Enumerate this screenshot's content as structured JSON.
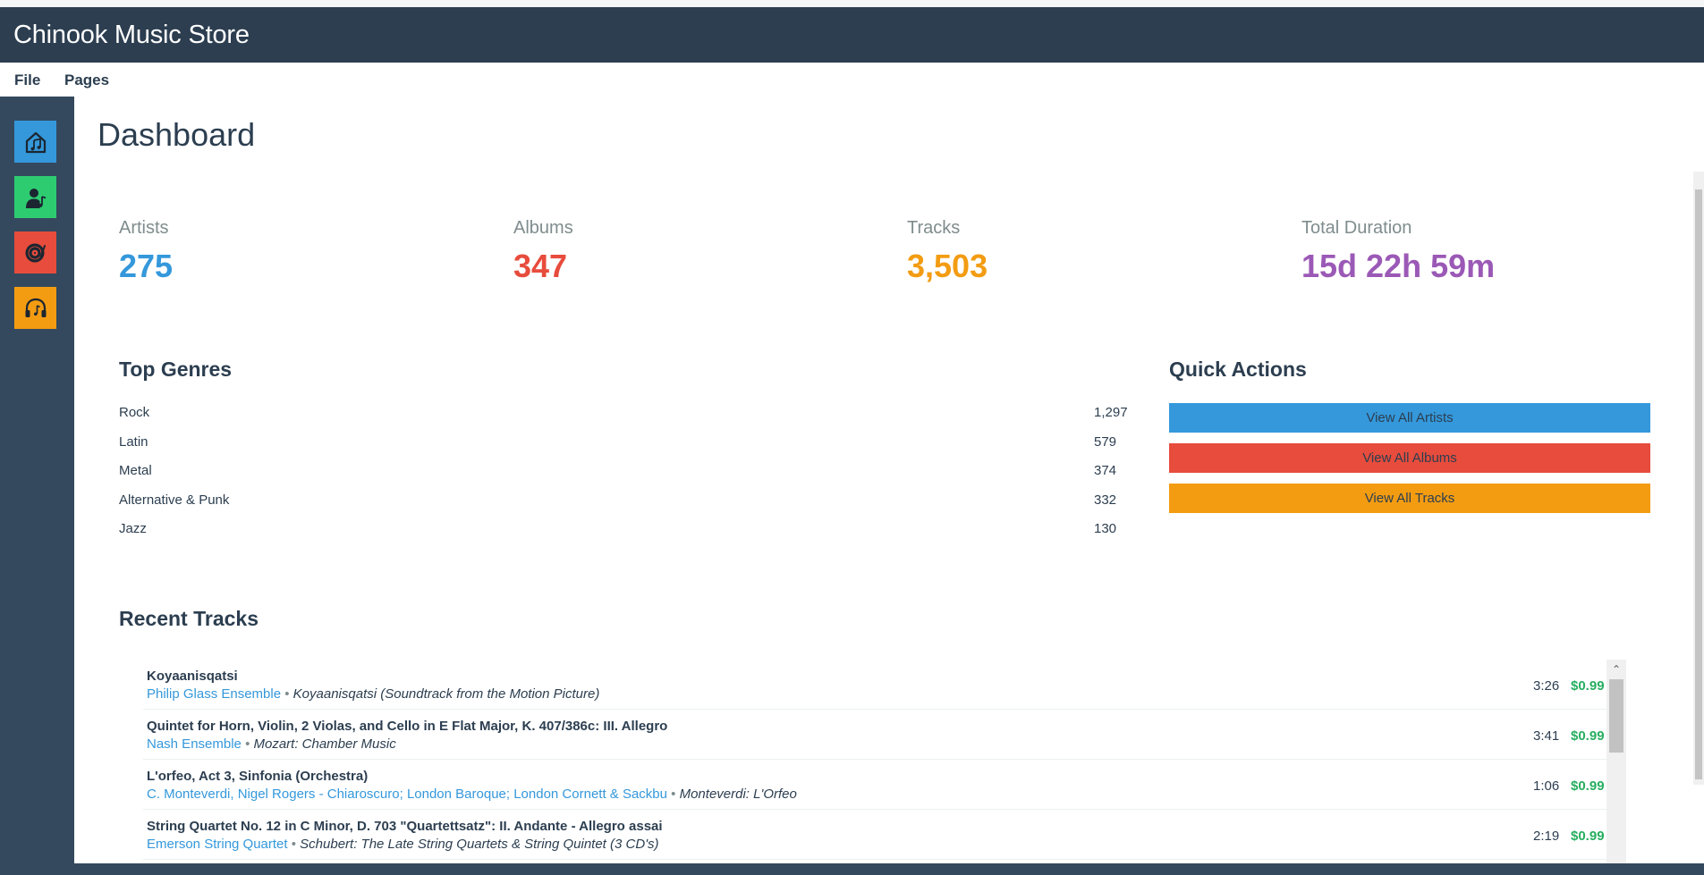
{
  "app": {
    "title": "Chinook Music Store"
  },
  "menu": {
    "file": "File",
    "pages": "Pages"
  },
  "sidebar": {
    "items": [
      {
        "name": "home",
        "icon": "home-music-icon",
        "color": "#3498db"
      },
      {
        "name": "artists",
        "icon": "artist-icon",
        "color": "#2ecc71"
      },
      {
        "name": "albums",
        "icon": "vinyl-record-icon",
        "color": "#e74c3c"
      },
      {
        "name": "tracks",
        "icon": "headphones-icon",
        "color": "#f39c12"
      }
    ]
  },
  "dashboard": {
    "title": "Dashboard",
    "stats": [
      {
        "label": "Artists",
        "value": "275",
        "color": "#3498db"
      },
      {
        "label": "Albums",
        "value": "347",
        "color": "#e74c3c"
      },
      {
        "label": "Tracks",
        "value": "3,503",
        "color": "#f39c12"
      },
      {
        "label": "Total Duration",
        "value": "15d 22h 59m",
        "color": "#9b59b6"
      }
    ],
    "top_genres": {
      "title": "Top Genres",
      "items": [
        {
          "name": "Rock",
          "count": "1,297"
        },
        {
          "name": "Latin",
          "count": "579"
        },
        {
          "name": "Metal",
          "count": "374"
        },
        {
          "name": "Alternative & Punk",
          "count": "332"
        },
        {
          "name": "Jazz",
          "count": "130"
        }
      ]
    },
    "quick_actions": {
      "title": "Quick Actions",
      "buttons": [
        {
          "label": "View All Artists",
          "color": "#3498db"
        },
        {
          "label": "View All Albums",
          "color": "#e74c3c"
        },
        {
          "label": "View All Tracks",
          "color": "#f39c12"
        }
      ]
    },
    "recent_tracks": {
      "title": "Recent Tracks",
      "separator": "•",
      "items": [
        {
          "name": "Koyaanisqatsi",
          "artist": "Philip Glass Ensemble",
          "album": "Koyaanisqatsi (Soundtrack from the Motion Picture)",
          "duration": "3:26",
          "price": "$0.99"
        },
        {
          "name": "Quintet for Horn, Violin, 2 Violas, and Cello in E Flat Major, K. 407/386c: III. Allegro",
          "artist": "Nash Ensemble",
          "album": "Mozart: Chamber Music",
          "duration": "3:41",
          "price": "$0.99"
        },
        {
          "name": "L'orfeo, Act 3, Sinfonia (Orchestra)",
          "artist": "C. Monteverdi, Nigel Rogers - Chiaroscuro; London Baroque; London Cornett & Sackbu",
          "album": "Monteverdi: L'Orfeo",
          "duration": "1:06",
          "price": "$0.99"
        },
        {
          "name": "String Quartet No. 12 in C Minor, D. 703 \"Quartettsatz\": II. Andante - Allegro assai",
          "artist": "Emerson String Quartet",
          "album": "Schubert: The Late String Quartets & String Quintet (3 CD's)",
          "duration": "2:19",
          "price": "$0.99"
        }
      ]
    }
  }
}
